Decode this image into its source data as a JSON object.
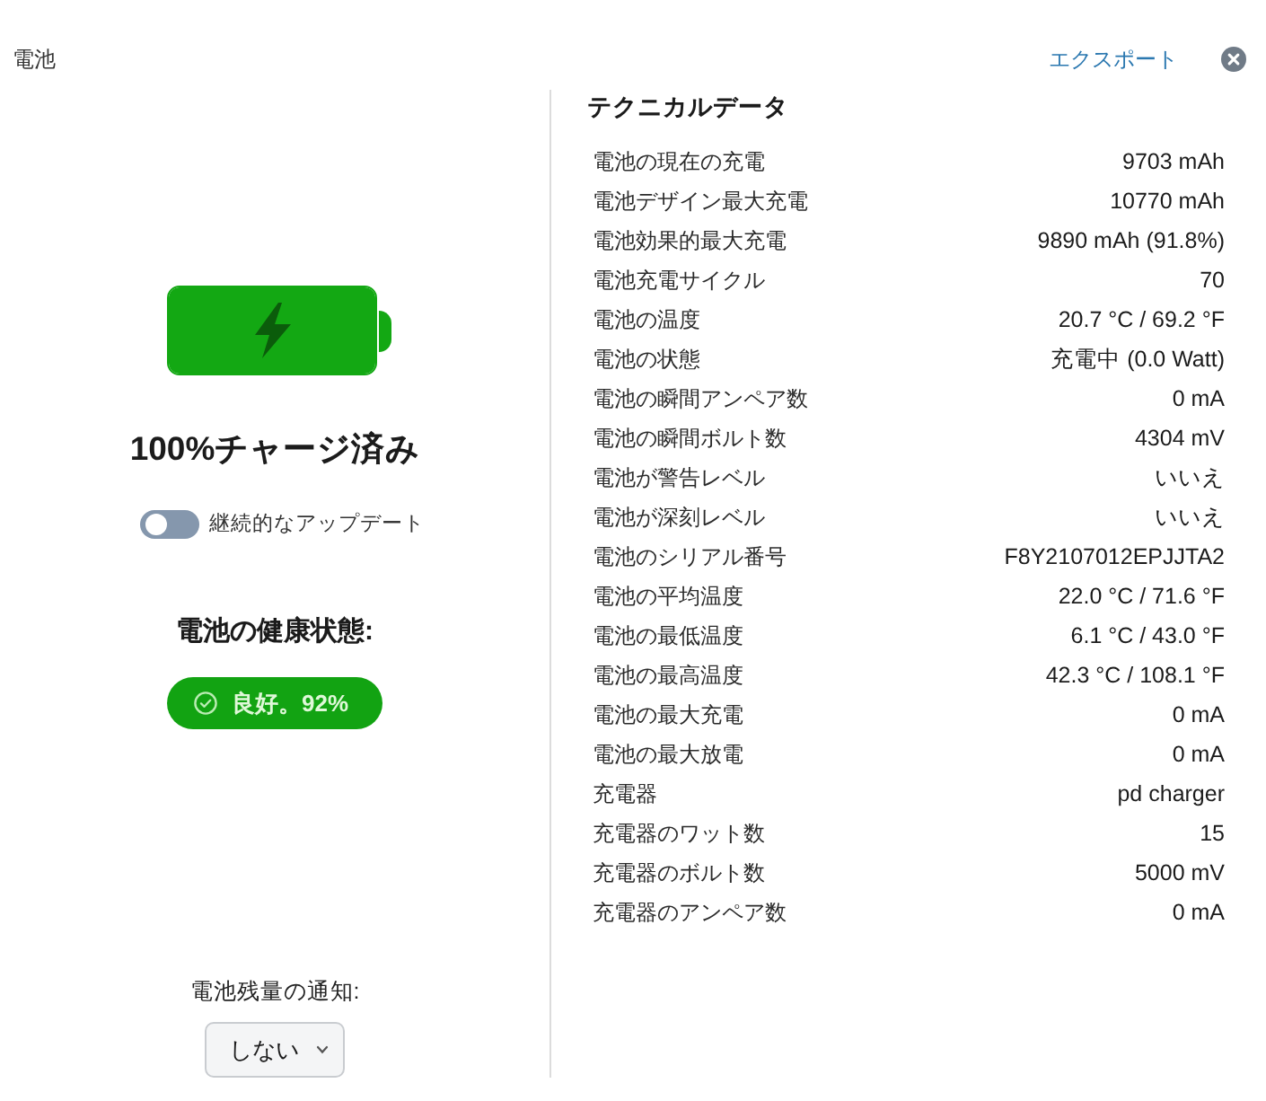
{
  "window": {
    "title": "電池"
  },
  "header": {
    "export_link": "エクスポート"
  },
  "battery": {
    "level": 1,
    "charging": true,
    "status": "100%チャージ済み",
    "continuous_update": {
      "label": "継続的なアップデート",
      "on": false
    },
    "health": {
      "heading": "電池の健康状態:",
      "badge": "良好。92%"
    },
    "notification": {
      "label": "電池残量の通知:",
      "value": "しない"
    }
  },
  "technical_data": {
    "title": "テクニカルデータ",
    "rows": [
      {
        "label": "電池の現在の充電",
        "value": "9703 mAh"
      },
      {
        "label": "電池デザイン最大充電",
        "value": "10770 mAh"
      },
      {
        "label": "電池効果的最大充電",
        "value": "9890 mAh (91.8%)"
      },
      {
        "label": "電池充電サイクル",
        "value": "70"
      },
      {
        "label": "電池の温度",
        "value": "20.7 °C / 69.2 °F"
      },
      {
        "label": "電池の状態",
        "value": "充電中 (0.0 Watt)"
      },
      {
        "label": "電池の瞬間アンペア数",
        "value": "0 mA"
      },
      {
        "label": "電池の瞬間ボルト数",
        "value": "4304 mV"
      },
      {
        "label": "電池が警告レベル",
        "value": "いいえ"
      },
      {
        "label": "電池が深刻レベル",
        "value": "いいえ"
      },
      {
        "label": "電池のシリアル番号",
        "value": "F8Y2107012EPJJTA2"
      },
      {
        "label": "電池の平均温度",
        "value": "22.0 °C / 71.6 °F"
      },
      {
        "label": "電池の最低温度",
        "value": "6.1 °C / 43.0 °F"
      },
      {
        "label": "電池の最高温度",
        "value": "42.3 °C / 108.1 °F"
      },
      {
        "label": "電池の最大充電",
        "value": "0 mA"
      },
      {
        "label": "電池の最大放電",
        "value": "0 mA"
      },
      {
        "label": "充電器",
        "value": "pd charger"
      },
      {
        "label": "充電器のワット数",
        "value": "15"
      },
      {
        "label": "充電器のボルト数",
        "value": "5000 mV"
      },
      {
        "label": "充電器のアンペア数",
        "value": "0 mA"
      }
    ]
  }
}
